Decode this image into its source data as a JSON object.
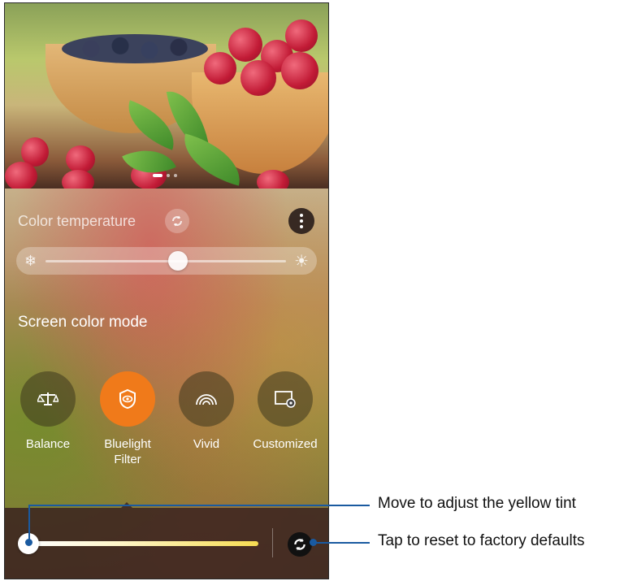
{
  "color_temperature": {
    "title": "Color temperature",
    "level": 0.55
  },
  "screen_color_mode": {
    "title": "Screen color mode",
    "modes": [
      {
        "label": "Balance",
        "icon": "balance-scale-icon",
        "selected": false
      },
      {
        "label": "Bluelight\nFilter",
        "icon": "bluelight-eye-shield-icon",
        "selected": true
      },
      {
        "label": "Vivid",
        "icon": "vivid-arcs-icon",
        "selected": false
      },
      {
        "label": "Customized",
        "icon": "customized-screen-gear-icon",
        "selected": false
      }
    ]
  },
  "yellow_tint": {
    "level": 0.0
  },
  "annotations": {
    "tint_slider": "Move to adjust the yellow tint",
    "reset_button": "Tap to reset to factory defaults"
  },
  "colors": {
    "accent": "#f07a1a",
    "callout": "#1a5aa0"
  }
}
